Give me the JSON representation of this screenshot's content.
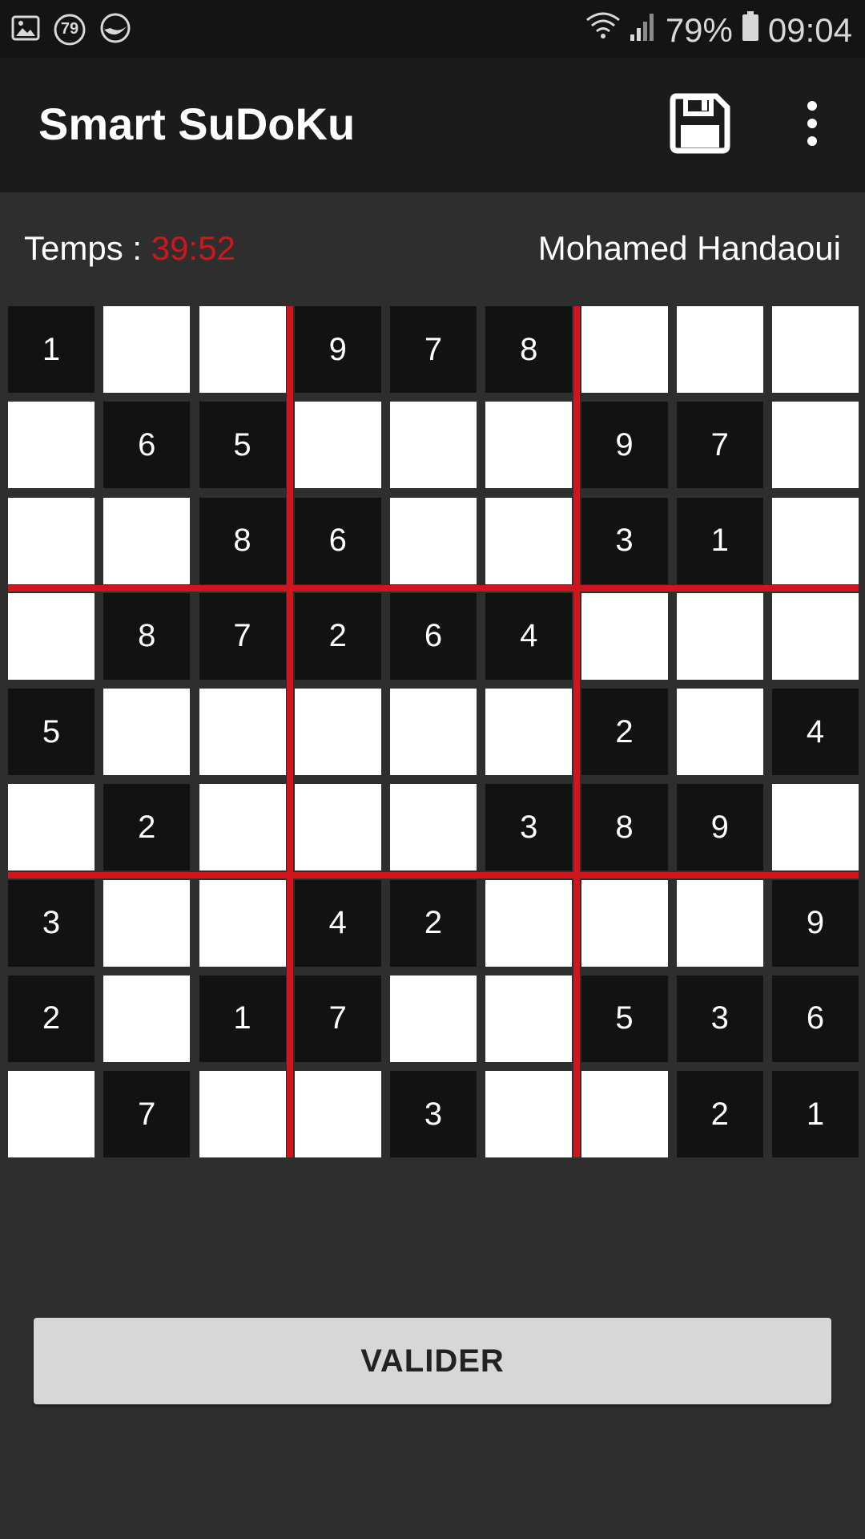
{
  "status_bar": {
    "notification_badge": "79",
    "battery_percent": "79%",
    "clock": "09:04",
    "icons": [
      "image-icon",
      "badge-icon",
      "app-icon",
      "wifi-icon",
      "signal-icon",
      "battery-icon"
    ]
  },
  "app_bar": {
    "title": "Smart SuDoKu",
    "save_icon": "floppy-disk-icon",
    "overflow_icon": "more-vert-icon"
  },
  "info": {
    "time_label": "Temps : ",
    "time_value": "39:52",
    "player_name": "Mohamed Handaoui"
  },
  "grid": {
    "rows": [
      [
        "1",
        "",
        "",
        "9",
        "7",
        "8",
        "",
        "",
        ""
      ],
      [
        "",
        "6",
        "5",
        "",
        "",
        "",
        "9",
        "7",
        ""
      ],
      [
        "",
        "",
        "8",
        "6",
        "",
        "",
        "3",
        "1",
        ""
      ],
      [
        "",
        "8",
        "7",
        "2",
        "6",
        "4",
        "",
        "",
        ""
      ],
      [
        "5",
        "",
        "",
        "",
        "",
        "",
        "2",
        "",
        "4"
      ],
      [
        "",
        "2",
        "",
        "",
        "",
        "3",
        "8",
        "9",
        ""
      ],
      [
        "3",
        "",
        "",
        "4",
        "2",
        "",
        "",
        "",
        "9"
      ],
      [
        "2",
        "",
        "1",
        "7",
        "",
        "",
        "5",
        "3",
        "6"
      ],
      [
        "",
        "7",
        "",
        "",
        "3",
        "",
        "",
        "2",
        "1"
      ]
    ]
  },
  "actions": {
    "validate_label": "VALIDER"
  },
  "colors": {
    "accent_red": "#d0161d",
    "given_cell": "#121212",
    "empty_cell": "#ffffff",
    "background": "#2e2e2e"
  }
}
